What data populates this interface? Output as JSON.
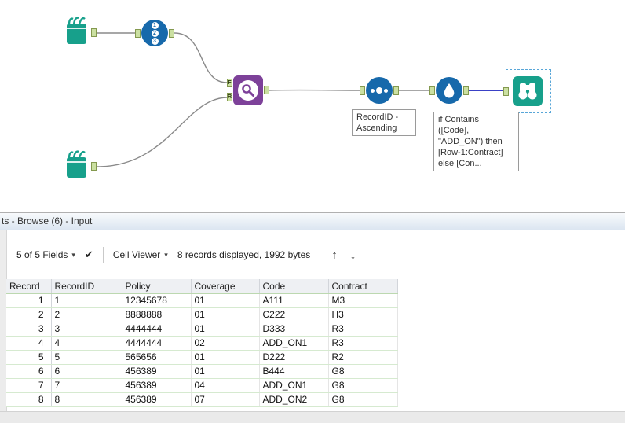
{
  "canvas": {
    "tools": {
      "recordid": {
        "badges": [
          "1",
          "2",
          "3"
        ]
      },
      "findreplace": {
        "input_top_label": "F",
        "input_bottom_label": "R"
      },
      "sort": {
        "annotation": "RecordID -\nAscending"
      },
      "formula": {
        "annotation": "if Contains\n([Code],\n\"ADD_ON\") then\n[Row-1:Contract]\nelse [Con..."
      }
    }
  },
  "results": {
    "title": "ts - Browse (6) - Input",
    "toolbar": {
      "fields_label": "5 of 5 Fields",
      "caret_icon": "▾",
      "check_icon": "✔",
      "cell_viewer_label": "Cell Viewer",
      "records_label": "8 records displayed, 1992 bytes",
      "up_icon": "↑",
      "down_icon": "↓"
    },
    "table": {
      "columns": [
        "Record",
        "RecordID",
        "Policy",
        "Coverage",
        "Code",
        "Contract"
      ],
      "rows": [
        [
          "1",
          "1",
          "12345678",
          "01",
          "A111",
          "M3"
        ],
        [
          "2",
          "2",
          "8888888",
          "01",
          "C222",
          "H3"
        ],
        [
          "3",
          "3",
          "4444444",
          "01",
          "D333",
          "R3"
        ],
        [
          "4",
          "4",
          "4444444",
          "02",
          "ADD_ON1",
          "R3"
        ],
        [
          "5",
          "5",
          "565656",
          "01",
          "D222",
          "R2"
        ],
        [
          "6",
          "6",
          "456389",
          "01",
          "B444",
          "G8"
        ],
        [
          "7",
          "7",
          "456389",
          "04",
          "ADD_ON1",
          "G8"
        ],
        [
          "8",
          "8",
          "456389",
          "07",
          "ADD_ON2",
          "G8"
        ]
      ]
    }
  }
}
